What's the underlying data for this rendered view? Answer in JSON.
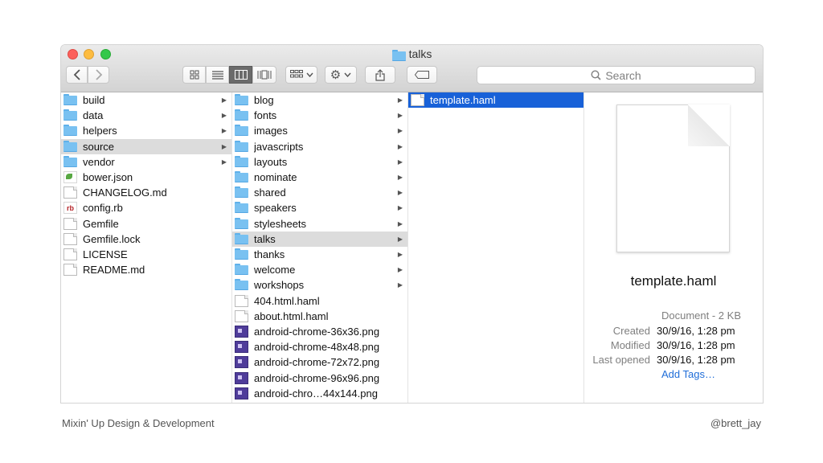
{
  "window": {
    "title": "talks",
    "search_placeholder": "Search"
  },
  "columns": [
    {
      "items": [
        {
          "label": "build",
          "kind": "folder",
          "arrow": true
        },
        {
          "label": "data",
          "kind": "folder",
          "arrow": true
        },
        {
          "label": "helpers",
          "kind": "folder",
          "arrow": true
        },
        {
          "label": "source",
          "kind": "folder",
          "arrow": true,
          "selected": "grey"
        },
        {
          "label": "vendor",
          "kind": "folder",
          "arrow": true
        },
        {
          "label": "bower.json",
          "kind": "json"
        },
        {
          "label": "CHANGELOG.md",
          "kind": "doc"
        },
        {
          "label": "config.rb",
          "kind": "rb"
        },
        {
          "label": "Gemfile",
          "kind": "doc"
        },
        {
          "label": "Gemfile.lock",
          "kind": "doc"
        },
        {
          "label": "LICENSE",
          "kind": "doc"
        },
        {
          "label": "README.md",
          "kind": "doc"
        }
      ]
    },
    {
      "items": [
        {
          "label": "blog",
          "kind": "folder",
          "arrow": true
        },
        {
          "label": "fonts",
          "kind": "folder",
          "arrow": true
        },
        {
          "label": "images",
          "kind": "folder",
          "arrow": true
        },
        {
          "label": "javascripts",
          "kind": "folder",
          "arrow": true
        },
        {
          "label": "layouts",
          "kind": "folder",
          "arrow": true
        },
        {
          "label": "nominate",
          "kind": "folder",
          "arrow": true
        },
        {
          "label": "shared",
          "kind": "folder",
          "arrow": true
        },
        {
          "label": "speakers",
          "kind": "folder",
          "arrow": true
        },
        {
          "label": "stylesheets",
          "kind": "folder",
          "arrow": true
        },
        {
          "label": "talks",
          "kind": "folder",
          "arrow": true,
          "selected": "grey"
        },
        {
          "label": "thanks",
          "kind": "folder",
          "arrow": true
        },
        {
          "label": "welcome",
          "kind": "folder",
          "arrow": true
        },
        {
          "label": "workshops",
          "kind": "folder",
          "arrow": true
        },
        {
          "label": "404.html.haml",
          "kind": "doc"
        },
        {
          "label": "about.html.haml",
          "kind": "doc"
        },
        {
          "label": "android-chrome-36x36.png",
          "kind": "png"
        },
        {
          "label": "android-chrome-48x48.png",
          "kind": "png"
        },
        {
          "label": "android-chrome-72x72.png",
          "kind": "png"
        },
        {
          "label": "android-chrome-96x96.png",
          "kind": "png"
        },
        {
          "label": "android-chro…44x144.png",
          "kind": "png"
        }
      ]
    },
    {
      "items": [
        {
          "label": "template.haml",
          "kind": "doc",
          "selected": "blue"
        }
      ]
    }
  ],
  "preview": {
    "name": "template.haml",
    "kind": "Document - 2 KB",
    "meta": [
      {
        "key": "Created",
        "value": "30/9/16, 1:28 pm"
      },
      {
        "key": "Modified",
        "value": "30/9/16, 1:28 pm"
      },
      {
        "key": "Last opened",
        "value": "30/9/16, 1:28 pm"
      }
    ],
    "add_tags": "Add Tags…"
  },
  "footer": {
    "left": "Mixin' Up Design & Development",
    "right": "@brett_jay"
  },
  "colors": {
    "selection_blue": "#1861d8",
    "selection_grey": "#dcdcdc",
    "folder": "#79c1f1",
    "link": "#1f6dd8"
  },
  "icons": {
    "back": "chevron-left-icon",
    "forward": "chevron-right-icon",
    "share": "share-icon",
    "tag": "tag-icon",
    "action": "gear-icon",
    "search": "magnifier-icon"
  }
}
